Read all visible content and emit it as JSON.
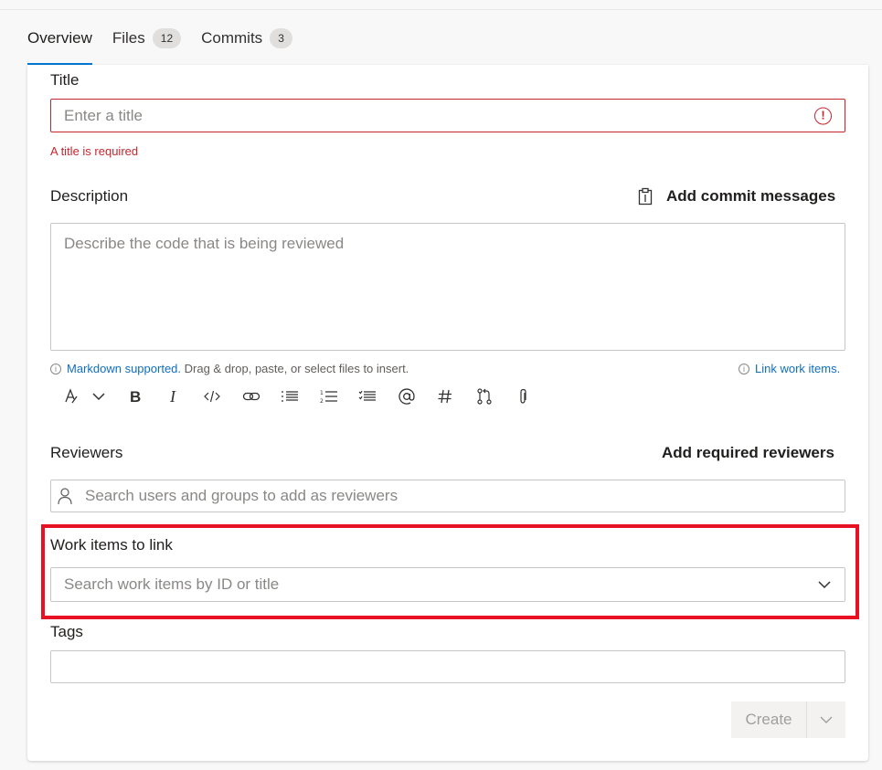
{
  "tabs": [
    {
      "label": "Overview",
      "count": null
    },
    {
      "label": "Files",
      "count": "12"
    },
    {
      "label": "Commits",
      "count": "3"
    }
  ],
  "form": {
    "title_label": "Title",
    "title_placeholder": "Enter a title",
    "title_error": "A title is required",
    "description_label": "Description",
    "add_commit_messages": "Add commit messages",
    "description_placeholder": "Describe the code that is being reviewed",
    "markdown_link": "Markdown supported.",
    "markdown_hint": " Drag & drop, paste, or select files to insert.",
    "link_work_items": "Link work items.",
    "reviewers_label": "Reviewers",
    "add_required_reviewers": "Add required reviewers",
    "reviewers_placeholder": "Search users and groups to add as reviewers",
    "work_items_label": "Work items to link",
    "work_items_placeholder": "Search work items by ID or title",
    "tags_label": "Tags",
    "tags_value": "",
    "create_button": "Create"
  },
  "toolbar_icons": [
    "format-icon",
    "chevron-down-icon",
    "bold-icon",
    "italic-icon",
    "code-icon",
    "link-icon",
    "bulleted-list-icon",
    "numbered-list-icon",
    "checklist-icon",
    "mention-icon",
    "hashtag-icon",
    "pull-request-icon",
    "attachment-icon"
  ],
  "colors": {
    "accent": "#0078d4",
    "error": "#c4262e",
    "link": "#106ebe",
    "highlight": "#e81123"
  }
}
